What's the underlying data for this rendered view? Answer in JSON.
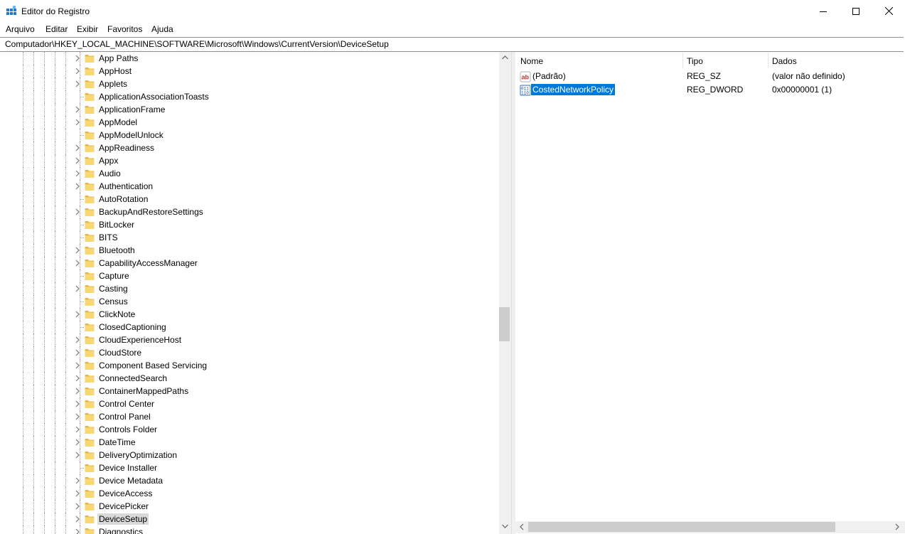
{
  "window": {
    "title": "Editor do Registro",
    "icons": {
      "app": "regedit-icon",
      "minimize": "minimize-icon",
      "maximize": "maximize-icon",
      "close": "close-icon"
    }
  },
  "menu": [
    "Arquivo",
    "Editar",
    "Exibir",
    "Favoritos",
    "Ajuda"
  ],
  "address": "Computador\\HKEY_LOCAL_MACHINE\\SOFTWARE\\Microsoft\\Windows\\CurrentVersion\\DeviceSetup",
  "tree": {
    "items": [
      {
        "label": "App Paths",
        "expandable": true
      },
      {
        "label": "AppHost",
        "expandable": true
      },
      {
        "label": "Applets",
        "expandable": true
      },
      {
        "label": "ApplicationAssociationToasts",
        "expandable": false
      },
      {
        "label": "ApplicationFrame",
        "expandable": true
      },
      {
        "label": "AppModel",
        "expandable": true
      },
      {
        "label": "AppModelUnlock",
        "expandable": false
      },
      {
        "label": "AppReadiness",
        "expandable": true
      },
      {
        "label": "Appx",
        "expandable": true
      },
      {
        "label": "Audio",
        "expandable": true
      },
      {
        "label": "Authentication",
        "expandable": true
      },
      {
        "label": "AutoRotation",
        "expandable": false
      },
      {
        "label": "BackupAndRestoreSettings",
        "expandable": true
      },
      {
        "label": "BitLocker",
        "expandable": false
      },
      {
        "label": "BITS",
        "expandable": false
      },
      {
        "label": "Bluetooth",
        "expandable": true
      },
      {
        "label": "CapabilityAccessManager",
        "expandable": true
      },
      {
        "label": "Capture",
        "expandable": false
      },
      {
        "label": "Casting",
        "expandable": true
      },
      {
        "label": "Census",
        "expandable": false
      },
      {
        "label": "ClickNote",
        "expandable": true
      },
      {
        "label": "ClosedCaptioning",
        "expandable": false
      },
      {
        "label": "CloudExperienceHost",
        "expandable": true
      },
      {
        "label": "CloudStore",
        "expandable": true
      },
      {
        "label": "Component Based Servicing",
        "expandable": true
      },
      {
        "label": "ConnectedSearch",
        "expandable": true
      },
      {
        "label": "ContainerMappedPaths",
        "expandable": true
      },
      {
        "label": "Control Center",
        "expandable": true
      },
      {
        "label": "Control Panel",
        "expandable": true
      },
      {
        "label": "Controls Folder",
        "expandable": true
      },
      {
        "label": "DateTime",
        "expandable": true
      },
      {
        "label": "DeliveryOptimization",
        "expandable": true
      },
      {
        "label": "Device Installer",
        "expandable": false
      },
      {
        "label": "Device Metadata",
        "expandable": true
      },
      {
        "label": "DeviceAccess",
        "expandable": true
      },
      {
        "label": "DevicePicker",
        "expandable": true
      },
      {
        "label": "DeviceSetup",
        "expandable": true,
        "selected": true
      },
      {
        "label": "Diagnostics",
        "expandable": true
      }
    ]
  },
  "values": {
    "columns": {
      "name": "Nome",
      "type": "Tipo",
      "data": "Dados"
    },
    "rows": [
      {
        "icon": "string-value-icon",
        "name": "(Padrão)",
        "type": "REG_SZ",
        "data": "(valor não definido)",
        "selected": false
      },
      {
        "icon": "binary-value-icon",
        "name": "CostedNetworkPolicy",
        "type": "REG_DWORD",
        "data": "0x00000001 (1)",
        "selected": true
      }
    ]
  },
  "colors": {
    "selection": "#0078d7",
    "tree_selection": "#d9d9d9",
    "folder": "#f8d775",
    "folder_dark": "#e6b84a"
  }
}
